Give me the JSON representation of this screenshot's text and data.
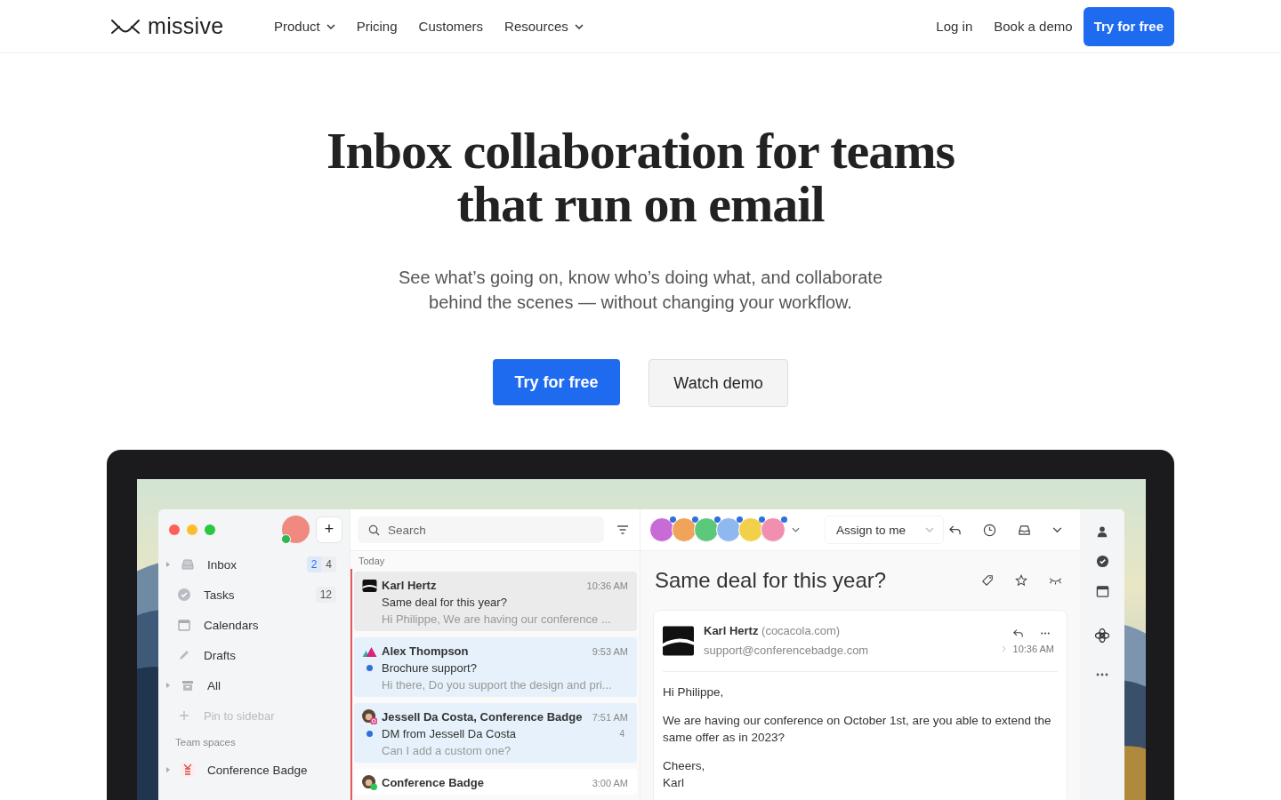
{
  "nav": {
    "logo": "missive",
    "links": [
      {
        "label": "Product",
        "dropdown": true
      },
      {
        "label": "Pricing",
        "dropdown": false
      },
      {
        "label": "Customers",
        "dropdown": false
      },
      {
        "label": "Resources",
        "dropdown": true
      }
    ],
    "login": "Log in",
    "demo": "Book a demo",
    "cta": "Try for free"
  },
  "hero": {
    "title_lines": [
      "Inbox collaboration for teams",
      "that run on email"
    ],
    "subtitle_lines": [
      "See what’s going on, know who’s doing what, and collaborate",
      "behind the scenes — without changing your workflow."
    ],
    "primary": "Try for free",
    "secondary": "Watch demo"
  },
  "app": {
    "sidebar": {
      "online": true,
      "add": "+",
      "items": [
        {
          "label": "Inbox",
          "kind": "inbox",
          "expandable": true,
          "badges": [
            {
              "text": "2",
              "kind": "unread"
            },
            {
              "text": "4",
              "kind": "count"
            }
          ]
        },
        {
          "label": "Tasks",
          "kind": "tasks",
          "expandable": false,
          "badges": [
            {
              "text": "12",
              "kind": "count"
            }
          ]
        },
        {
          "label": "Calendars",
          "kind": "calendars",
          "expandable": false
        },
        {
          "label": "Drafts",
          "kind": "drafts",
          "expandable": false
        },
        {
          "label": "All",
          "kind": "all",
          "expandable": true
        }
      ],
      "pin": "Pin to sidebar",
      "section": "Team spaces",
      "teams": [
        {
          "label": "Conference Badge",
          "kind": "team",
          "expandable": true
        }
      ]
    },
    "list": {
      "search_placeholder": "Search",
      "group": "Today",
      "conversations": [
        {
          "from": "Karl Hertz",
          "time": "10:36 AM",
          "subject": "Same deal for this year?",
          "preview": "Hi Philippe, We are having our conference ...",
          "selected": true,
          "unread": false,
          "kind": "logo"
        },
        {
          "from": "Alex Thompson",
          "time": "9:53 AM",
          "subject": "Brochure support?",
          "preview": "Hi there, Do you support the design and pri...",
          "selected": false,
          "unread": true,
          "kind": "triangles"
        },
        {
          "from": "Jessell Da Costa, Conference Badge",
          "time": "7:51 AM",
          "subject": "DM from Jessell Da Costa",
          "count": "4",
          "preview": "Can I add a custom one?",
          "selected": false,
          "unread": true,
          "kind": "person-camera"
        },
        {
          "from": "Conference Badge",
          "time": "3:00 AM",
          "selected": false,
          "unread": false,
          "kind": "person-chat"
        }
      ]
    },
    "conversation": {
      "assignees": [
        {
          "color": "#c86bd6",
          "online": true
        },
        {
          "color": "#f0a35a",
          "online": true
        },
        {
          "color": "#5cc97a",
          "online": true
        },
        {
          "color": "#8fb7f0",
          "online": true
        },
        {
          "color": "#f2d04a",
          "online": true
        },
        {
          "color": "#f08fb0",
          "online": true
        }
      ],
      "assign": "Assign to me",
      "subject": "Same deal for this year?",
      "message": {
        "sender": "Karl Hertz",
        "domain": "(cocacola.com)",
        "to": "support@conferencebadge.com",
        "time": "10:36 AM",
        "body": [
          [
            "Hi Philippe,"
          ],
          [
            "We are having our conference on October 1st, are you able to extend the same offer as in 2023?"
          ],
          [
            "Cheers,",
            "Karl"
          ]
        ]
      }
    }
  }
}
